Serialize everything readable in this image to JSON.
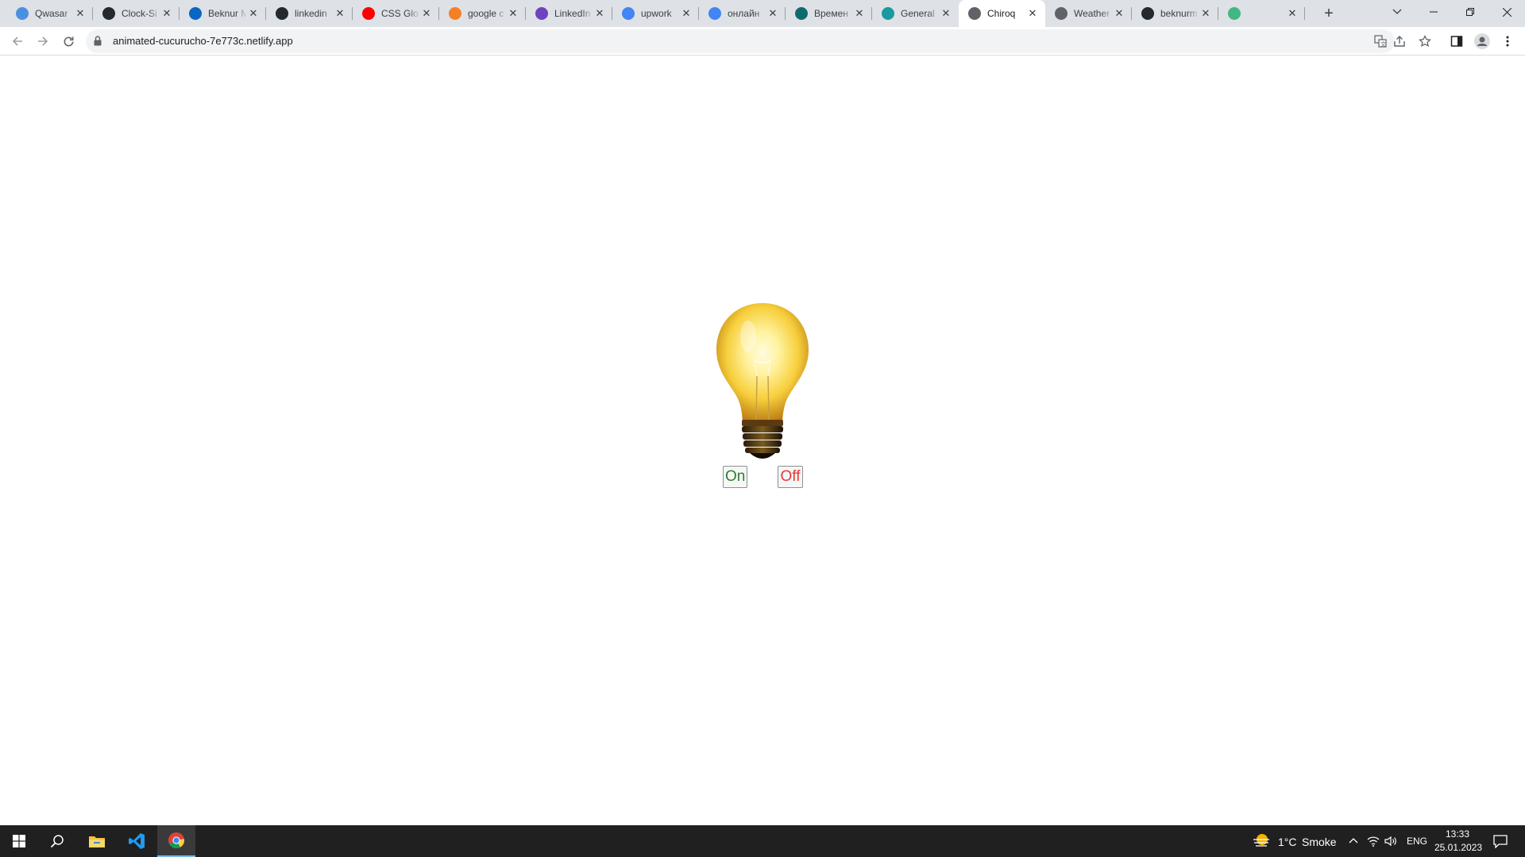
{
  "browser": {
    "tabs": [
      {
        "title": "Qwasar",
        "favicon": "qwasar-icon",
        "color": "#4a90e2"
      },
      {
        "title": "Clock-Si",
        "favicon": "github-icon",
        "color": "#24292f"
      },
      {
        "title": "Beknur M",
        "favicon": "linkedin-icon",
        "color": "#0a66c2"
      },
      {
        "title": "linkedin",
        "favicon": "github-icon",
        "color": "#24292f"
      },
      {
        "title": "CSS Glo",
        "favicon": "youtube-icon",
        "color": "#ff0000"
      },
      {
        "title": "google c",
        "favicon": "stackoverflow-icon",
        "color": "#f48024"
      },
      {
        "title": "LinkedIn",
        "favicon": "generic-purple-icon",
        "color": "#6f42c1"
      },
      {
        "title": "upwork",
        "favicon": "google-icon",
        "color": "#4285f4"
      },
      {
        "title": "онлайн",
        "favicon": "google-icon",
        "color": "#4285f4"
      },
      {
        "title": "Времен",
        "favicon": "generic-teal-icon",
        "color": "#0f6b6b"
      },
      {
        "title": "General",
        "favicon": "diamond-icon",
        "color": "#1a9aa0"
      },
      {
        "title": "Chiroq",
        "favicon": "globe-icon",
        "color": "#5f6368",
        "active": true
      },
      {
        "title": "Weather",
        "favicon": "globe-icon",
        "color": "#5f6368"
      },
      {
        "title": "beknurm",
        "favicon": "github-icon",
        "color": "#24292f"
      },
      {
        "title": "",
        "favicon": "vue-icon",
        "color": "#41b883"
      }
    ],
    "url": "animated-cucurucho-7e773c.netlify.app"
  },
  "page": {
    "on_label": "On",
    "off_label": "Off",
    "on_color": "#2e7d32",
    "off_color": "#e53935",
    "bulb_state": "on"
  },
  "taskbar": {
    "weather_temp": "1°C",
    "weather_text": "Smoke",
    "language": "ENG",
    "time": "13:33",
    "date": "25.01.2023"
  }
}
